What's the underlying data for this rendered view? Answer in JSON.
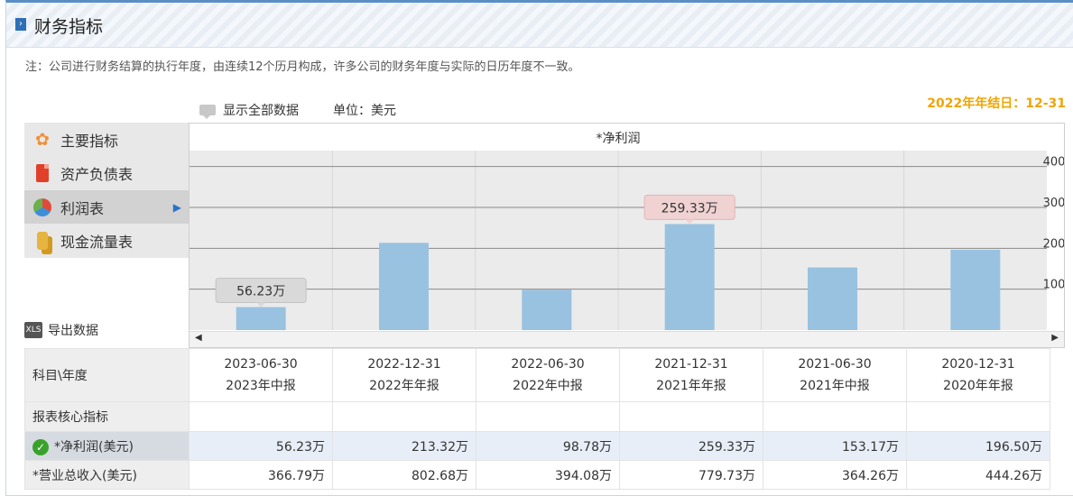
{
  "header": {
    "title": "财务指标"
  },
  "note": "注：公司进行财务结算的执行年度，由连续12个历月构成，许多公司的财务年度与实际的日历年度不一致。",
  "year_end": "2022年年结日：12-31",
  "toolbar": {
    "show_all": "显示全部数据",
    "unit": "单位：美元"
  },
  "menu": {
    "items": [
      {
        "label": "主要指标",
        "icon": "flower-icon"
      },
      {
        "label": "资产负债表",
        "icon": "document-icon"
      },
      {
        "label": "利润表",
        "icon": "pie-chart-icon",
        "active": true
      },
      {
        "label": "现金流量表",
        "icon": "coins-icon"
      }
    ]
  },
  "export_label": "导出数据",
  "chart_data": {
    "type": "bar",
    "title": "*净利润",
    "categories": [
      "2023-06-30",
      "2022-12-31",
      "2022-06-30",
      "2021-12-31",
      "2021-06-30",
      "2020-12-31"
    ],
    "values": [
      56.23,
      213.32,
      98.78,
      259.33,
      153.17,
      196.5
    ],
    "ylim": [
      0,
      450
    ],
    "yticks": [
      100,
      200,
      300,
      400
    ],
    "tooltips": [
      {
        "index": 0,
        "text": "56.23万",
        "style": "gray"
      },
      {
        "index": 3,
        "text": "259.33万",
        "style": "red"
      }
    ],
    "bar_color": "#99c2e0",
    "grid": true
  },
  "table": {
    "corner": "科目\\年度",
    "columns": [
      {
        "date": "2023-06-30",
        "report": "2023年中报"
      },
      {
        "date": "2022-12-31",
        "report": "2022年年报"
      },
      {
        "date": "2022-06-30",
        "report": "2022年中报"
      },
      {
        "date": "2021-12-31",
        "report": "2021年年报"
      },
      {
        "date": "2021-06-30",
        "report": "2021年中报"
      },
      {
        "date": "2020-12-31",
        "report": "2020年年报"
      }
    ],
    "section": "报表核心指标",
    "rows": [
      {
        "label": "*净利润(美元)",
        "values": [
          "56.23万",
          "213.32万",
          "98.78万",
          "259.33万",
          "153.17万",
          "196.50万"
        ]
      },
      {
        "label": "*营业总收入(美元)",
        "values": [
          "366.79万",
          "802.68万",
          "394.08万",
          "779.73万",
          "364.26万",
          "444.26万"
        ]
      }
    ]
  }
}
